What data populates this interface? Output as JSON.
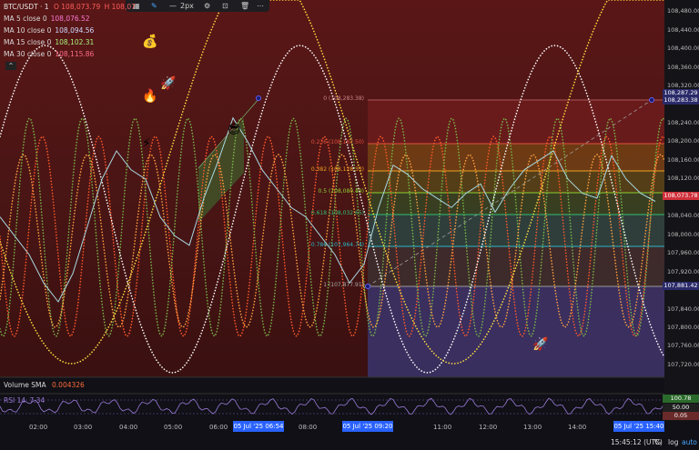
{
  "symbol": {
    "title": "BTC/USDT · 1",
    "open": "O 108,073.79",
    "high": "H 108,07"
  },
  "toolbar": {
    "width_label": "2px"
  },
  "ma_legend": [
    {
      "label": "MA 5 close 0",
      "value": "108,076.52",
      "color": "#ff7ad9"
    },
    {
      "label": "MA 10 close 0",
      "value": "108,094.56",
      "color": "#cfd8ff"
    },
    {
      "label": "MA 15 close 0",
      "value": "108,102.31",
      "color": "#a6f07a"
    },
    {
      "label": "MA 30 close 0",
      "value": "108,115.86",
      "color": "#ff6b8b"
    }
  ],
  "fib_levels": [
    {
      "label": "0 (108,283.38)"
    },
    {
      "label": "0.236 (108,187.50)"
    },
    {
      "label": "0.382 (108,128.33)"
    },
    {
      "label": "0.5 (108,080.49)"
    },
    {
      "label": "0.618 (108,032.65)"
    },
    {
      "label": "0.786 (107,964.74)"
    },
    {
      "label": "1 (107,877.91)"
    }
  ],
  "price_axis": [
    "108,480.00",
    "108,440.00",
    "108,400.00",
    "108,360.00",
    "108,320.00",
    "108,240.00",
    "108,200.00",
    "108,160.00",
    "108,120.00",
    "108,080.00",
    "108,040.00",
    "108,000.00",
    "107,960.00",
    "107,920.00",
    "107,840.00",
    "107,800.00",
    "107,760.00",
    "107,720.00"
  ],
  "price_tags": {
    "top1": "108,287.29",
    "top2": "108,283.38",
    "current": "108,073.78",
    "low": "107,881.42"
  },
  "volume": {
    "label": "Volume SMA",
    "value": "0.004326"
  },
  "rsi": {
    "label": "RSI 14",
    "value": "7.34",
    "axis": [
      "100.78",
      "50.00",
      "0.05"
    ]
  },
  "time_axis": [
    "02:00",
    "03:00",
    "04:00",
    "05:00",
    "06:00",
    "08:00",
    "11:00",
    "12:00",
    "13:00",
    "14:00"
  ],
  "time_tags": [
    "05 Jul '25 06:54",
    "05 Jul '25 09:20",
    "05 Jul '25 15:40"
  ],
  "bottom": {
    "clock": "15:45:12 (UTC)",
    "percent": "%",
    "log": "log",
    "auto": "auto"
  },
  "emoji": {
    "money": "💰",
    "fire": "🔥",
    "rocket": "🚀",
    "zap": "⚡",
    "cool": "😎"
  },
  "chart_data": {
    "type": "line",
    "series": [
      {
        "values": [
          108040,
          108000,
          107960,
          107900,
          107860,
          107920,
          108020,
          108120,
          108180,
          108140,
          108120,
          108040,
          108000,
          107980,
          108080,
          108160,
          108250,
          108200,
          108140,
          108100,
          108060,
          108040,
          108000,
          107960,
          107900,
          107940,
          108060,
          108150,
          108130,
          108100,
          108080,
          108060,
          108090,
          108110,
          108050,
          108100,
          108140,
          108160,
          108180,
          108120,
          108090,
          108080,
          108170,
          108120,
          108090,
          108073
        ]
      }
    ]
  }
}
